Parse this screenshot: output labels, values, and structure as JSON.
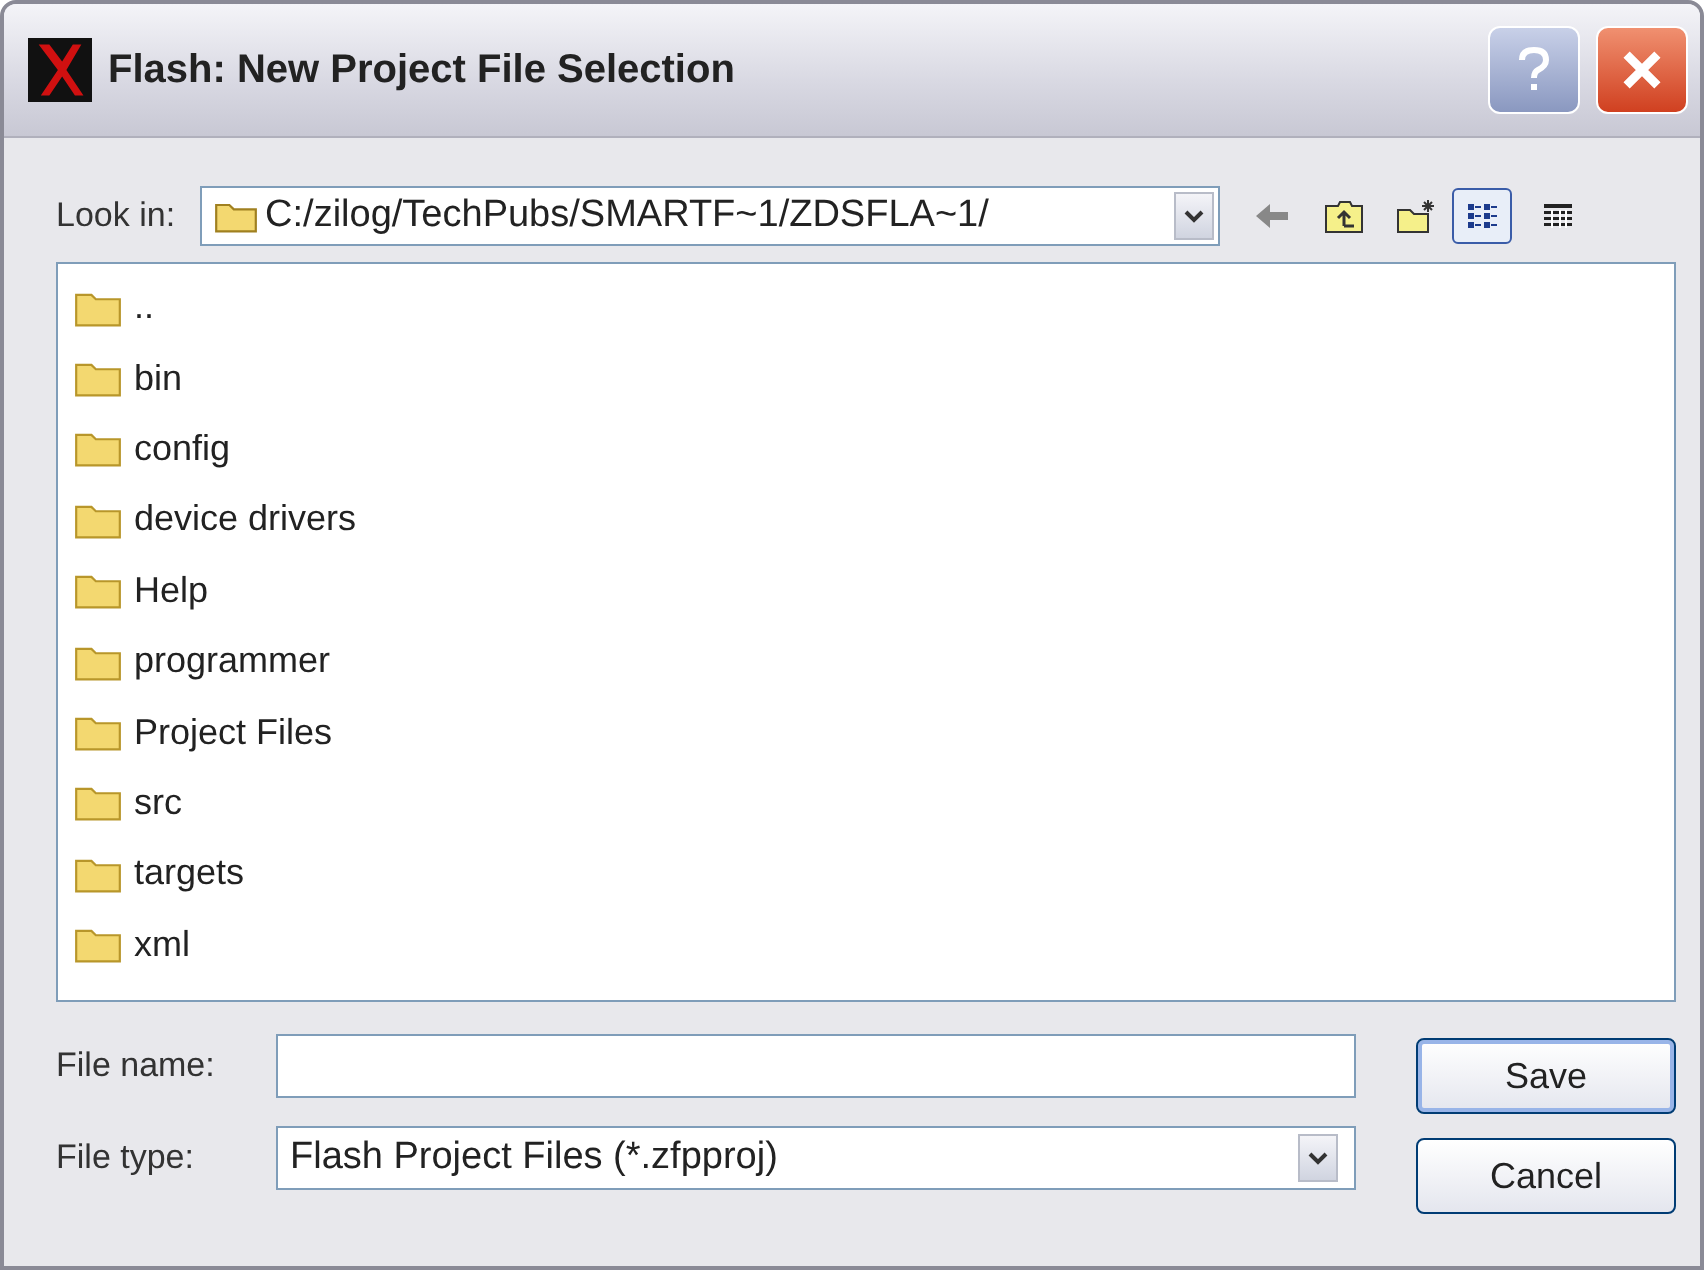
{
  "window": {
    "title": "Flash: New Project File Selection"
  },
  "look_in": {
    "label": "Look in:",
    "value": "C:/zilog/TechPubs/SMARTF~1/ZDSFLA~1/"
  },
  "view_modes": [
    {
      "kind": "list",
      "selected": true
    },
    {
      "kind": "details",
      "selected": false
    }
  ],
  "files": [
    {
      "name": ".."
    },
    {
      "name": "bin"
    },
    {
      "name": "config"
    },
    {
      "name": "device drivers"
    },
    {
      "name": "Help"
    },
    {
      "name": "programmer"
    },
    {
      "name": "Project Files"
    },
    {
      "name": "src"
    },
    {
      "name": "targets"
    },
    {
      "name": "xml"
    }
  ],
  "file_name": {
    "label": "File name:"
  },
  "file_type": {
    "label": "File type:",
    "value": "Flash Project Files (*.zfpproj)"
  },
  "buttons": [
    "Save",
    "Cancel"
  ]
}
